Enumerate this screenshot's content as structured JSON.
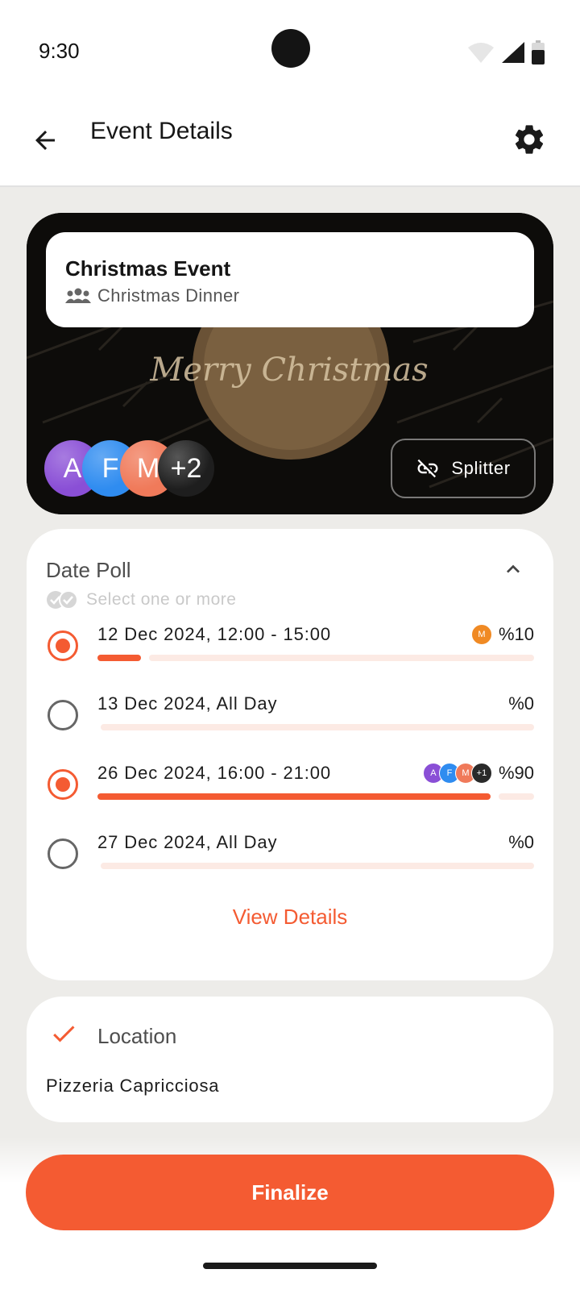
{
  "status_bar": {
    "time": "9:30"
  },
  "app_bar": {
    "title": "Event Details"
  },
  "event": {
    "name": "Christmas Event",
    "group": "Christmas Dinner",
    "background_text": "Merry Christmas",
    "avatars": [
      {
        "initial": "A",
        "color": "#8A4FD6"
      },
      {
        "initial": "F",
        "color": "#2F8CF0"
      },
      {
        "initial": "M",
        "color": "#F07A5A"
      },
      {
        "initial": "+2",
        "color": "#1E1E1E"
      }
    ],
    "splitter_label": "Splitter"
  },
  "poll": {
    "title": "Date Poll",
    "hint": "Select one or more",
    "options": [
      {
        "label": "12 Dec 2024, 12:00 - 15:00",
        "percent_text": "%10",
        "fraction": 0.1,
        "selected": true,
        "voters": [
          {
            "initial": "M",
            "color": "#F08A24"
          }
        ]
      },
      {
        "label": "13 Dec 2024, All Day",
        "percent_text": "%0",
        "fraction": 0,
        "selected": false,
        "voters": []
      },
      {
        "label": "26 Dec 2024, 16:00 - 21:00",
        "percent_text": "%90",
        "fraction": 0.9,
        "selected": true,
        "voters": [
          {
            "initial": "A",
            "color": "#8A4FD6"
          },
          {
            "initial": "F",
            "color": "#2F8CF0"
          },
          {
            "initial": "M",
            "color": "#F07A5A"
          },
          {
            "initial": "+1",
            "color": "#2A2A2A"
          }
        ]
      },
      {
        "label": "27 Dec 2024, All Day",
        "percent_text": "%0",
        "fraction": 0,
        "selected": false,
        "voters": []
      }
    ],
    "view_details": "View Details"
  },
  "location": {
    "title": "Location",
    "value": "Pizzeria Capricciosa"
  },
  "finalize_label": "Finalize",
  "colors": {
    "accent": "#F45B32",
    "track": "#FCEAE4"
  }
}
